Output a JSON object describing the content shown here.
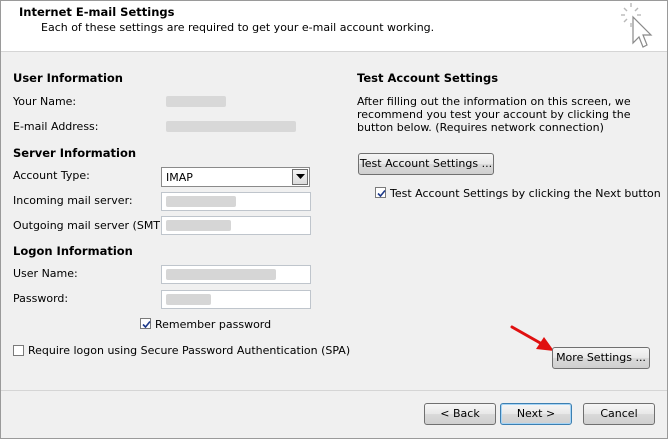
{
  "header": {
    "title": "Internet E-mail Settings",
    "subtitle": "Each of these settings are required to get your e-mail account working."
  },
  "user_info": {
    "heading": "User Information",
    "name_label": "Your Name:",
    "email_label": "E-mail Address:"
  },
  "server_info": {
    "heading": "Server Information",
    "account_type_label": "Account Type:",
    "account_type_value": "IMAP",
    "incoming_label": "Incoming mail server:",
    "outgoing_label": "Outgoing mail server (SMTP):"
  },
  "logon_info": {
    "heading": "Logon Information",
    "username_label": "User Name:",
    "password_label": "Password:",
    "remember_label": "Remember password",
    "remember_checked": true,
    "spa_label": "Require logon using Secure Password Authentication (SPA)",
    "spa_checked": false
  },
  "test": {
    "heading": "Test Account Settings",
    "description": "After filling out the information on this screen, we recommend you test your account by clicking the button below. (Requires network connection)",
    "button_label": "Test Account Settings ...",
    "next_checkbox_label": "Test Account Settings by clicking the Next button",
    "next_checkbox_checked": true
  },
  "more_settings_label": "More Settings ...",
  "footer": {
    "back_label": "< Back",
    "next_label": "Next >",
    "cancel_label": "Cancel"
  },
  "colors": {
    "background": "#f0f0f0",
    "header": "#ffffff",
    "annotation_arrow": "#e01010"
  }
}
